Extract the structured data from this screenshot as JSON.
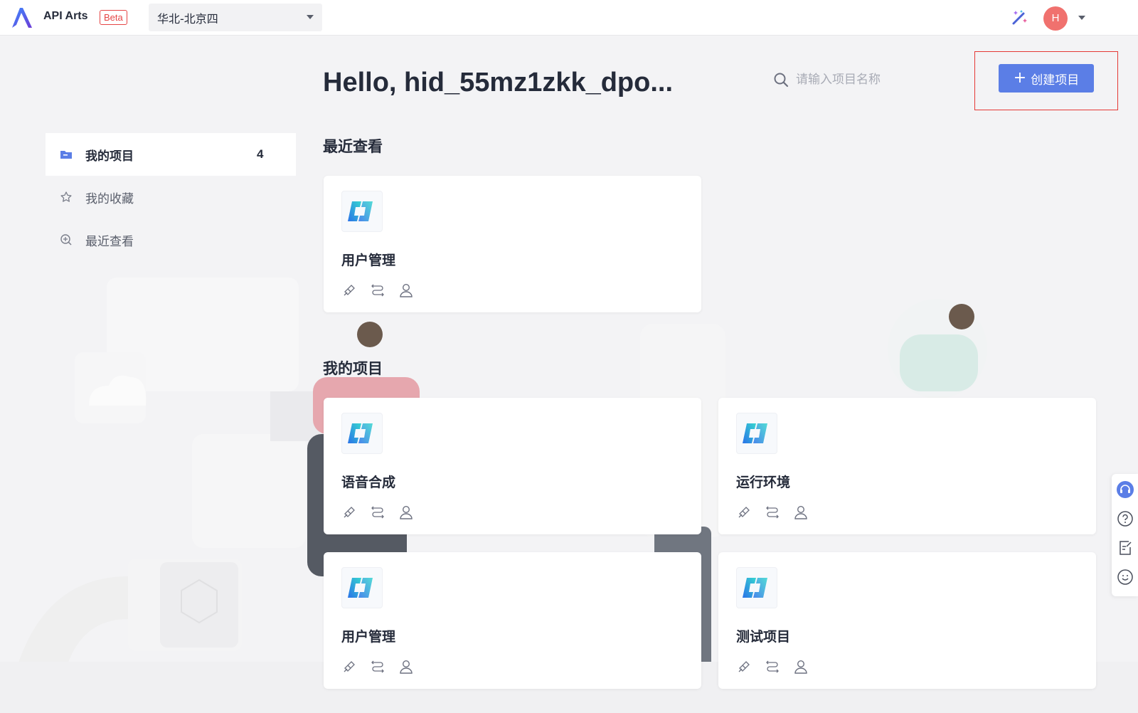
{
  "header": {
    "app_name": "API Arts",
    "beta_label": "Beta",
    "region": "华北-北京四",
    "avatar_initial": "H"
  },
  "greeting": "Hello, hid_55mz1zkk_dpo...",
  "search": {
    "placeholder": "请输入项目名称"
  },
  "create_button_label": "创建项目",
  "sidebar": {
    "items": [
      {
        "label": "我的项目",
        "count": "4",
        "icon": "folder-icon",
        "active": true
      },
      {
        "label": "我的收藏",
        "icon": "star-icon"
      },
      {
        "label": "最近查看",
        "icon": "recent-icon"
      }
    ]
  },
  "recent": {
    "title": "最近查看",
    "projects": [
      {
        "name": "用户管理"
      }
    ]
  },
  "mine": {
    "title": "我的项目",
    "projects": [
      {
        "name": "语音合成"
      },
      {
        "name": "运行环境"
      },
      {
        "name": "用户管理"
      },
      {
        "name": "测试项目"
      }
    ]
  },
  "colors": {
    "accent": "#5b7ee6",
    "highlight_border": "#e53935",
    "avatar_bg": "#f0716e",
    "beta": "#e54545"
  }
}
